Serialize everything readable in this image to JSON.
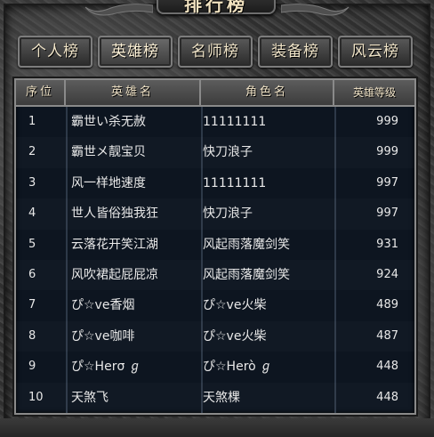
{
  "title": "排行榜",
  "tabs": [
    {
      "label": "个人榜",
      "active": false
    },
    {
      "label": "英雄榜",
      "active": true
    },
    {
      "label": "名师榜",
      "active": false
    },
    {
      "label": "装备榜",
      "active": false
    },
    {
      "label": "风云榜",
      "active": false
    }
  ],
  "table": {
    "headers": [
      "序位",
      "英雄名",
      "角色名",
      "英雄等级"
    ],
    "rows": [
      {
        "rank": "1",
        "hero": "霸世い杀无赦",
        "role": "11111111",
        "level": "999"
      },
      {
        "rank": "2",
        "hero": "霸世メ靓宝贝",
        "role": "快刀浪子",
        "level": "999"
      },
      {
        "rank": "3",
        "hero": "风一样地速度",
        "role": "11111111",
        "level": "997"
      },
      {
        "rank": "4",
        "hero": "世人皆俗独我狂",
        "role": "快刀浪子",
        "level": "997"
      },
      {
        "rank": "5",
        "hero": "云落花开笑江湖",
        "role": "风起雨落魔剑笑",
        "level": "931"
      },
      {
        "rank": "6",
        "hero": "风吹裙起屁屁凉",
        "role": "风起雨落魔剑笑",
        "level": "924"
      },
      {
        "rank": "7",
        "hero": "ぴ☆ve香烟",
        "role": "ぴ☆ve火柴",
        "level": "489"
      },
      {
        "rank": "8",
        "hero": "ぴ☆ve咖啡",
        "role": "ぴ☆ve火柴",
        "level": "487"
      },
      {
        "rank": "9",
        "hero": "ぴ☆Herσ ℊ",
        "role": "ぴ☆Herò ℊ",
        "level": "448"
      },
      {
        "rank": "10",
        "hero": "天煞飞",
        "role": "天煞棵",
        "level": "448"
      }
    ]
  }
}
